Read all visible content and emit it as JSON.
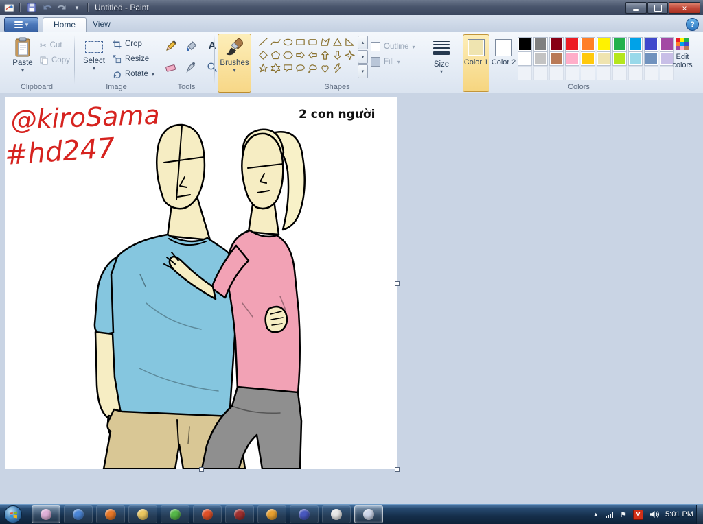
{
  "icons": {
    "dropdown": "▾",
    "scroll_up": "▴",
    "scroll_down": "▾",
    "help": "?",
    "close": "×",
    "hidden_icons": "▲",
    "text_tool": "A",
    "cut": "✂",
    "flag": "⚑",
    "red_badge": "V"
  },
  "window": {
    "title": "Untitled - Paint"
  },
  "tabs": {
    "home": "Home",
    "view": "View"
  },
  "ribbon": {
    "clipboard": {
      "label": "Clipboard",
      "paste": "Paste",
      "cut": "Cut",
      "copy": "Copy"
    },
    "image": {
      "label": "Image",
      "select": "Select",
      "crop": "Crop",
      "resize": "Resize",
      "rotate": "Rotate"
    },
    "tools": {
      "label": "Tools"
    },
    "brushes": {
      "label": "Brushes"
    },
    "shapes": {
      "label": "Shapes",
      "outline": "Outline",
      "fill": "Fill",
      "items": [
        "line",
        "curve",
        "oval",
        "rectangle",
        "rounded-rectangle",
        "polygon",
        "triangle",
        "right-triangle",
        "diamond",
        "pentagon",
        "hexagon",
        "right-arrow",
        "left-arrow",
        "up-arrow",
        "down-arrow",
        "four-point-star",
        "five-point-star",
        "six-point-star",
        "rounded-callout",
        "oval-callout",
        "cloud-callout",
        "heart",
        "lightning"
      ]
    },
    "size": {
      "label": "Size"
    },
    "colors": {
      "label": "Colors",
      "color1_label": "Color 1",
      "color2_label": "Color 2",
      "edit_label": "Edit colors",
      "color1_value": "#EFE4B0",
      "color2_value": "#FFFFFF",
      "palette": [
        [
          "#000000",
          "#7F7F7F",
          "#880015",
          "#ED1C24",
          "#FF7F27",
          "#FFF200",
          "#22B14C",
          "#00A2E8",
          "#3F48CC",
          "#A349A4"
        ],
        [
          "#FFFFFF",
          "#C3C3C3",
          "#B97A57",
          "#FFAEC9",
          "#FFC90E",
          "#EFE4B0",
          "#B5E61D",
          "#99D9EA",
          "#7092BE",
          "#C8BFE7"
        ]
      ]
    }
  },
  "canvas": {
    "signature_line1": "@kiroSama",
    "signature_line2": "#hd247",
    "caption": "2 con người",
    "drawing_colors": {
      "skin": "#F6EDC3",
      "shirt_blue": "#85C6DF",
      "shirt_pink": "#F2A2B5",
      "pants_tan": "#D9C795",
      "pants_gray": "#8F8F8F",
      "signature_red": "#D6231F"
    }
  },
  "taskbar": {
    "clock": "5:01 PM",
    "apps": [
      {
        "name": "photo-app",
        "color": "#e0b0d8",
        "active": true
      },
      {
        "name": "media-player",
        "color": "#4a86d8",
        "active": false
      },
      {
        "name": "firefox",
        "color": "#e87828",
        "active": false
      },
      {
        "name": "file-explorer",
        "color": "#ecc860",
        "active": false
      },
      {
        "name": "antivirus",
        "color": "#55b848",
        "active": false
      },
      {
        "name": "browser",
        "color": "#e05028",
        "active": false
      },
      {
        "name": "app-red",
        "color": "#a03030",
        "active": false
      },
      {
        "name": "folder-orange",
        "color": "#e8a030",
        "active": false
      },
      {
        "name": "video-app",
        "color": "#4858c0",
        "active": false
      },
      {
        "name": "chrome",
        "color": "#e8e8e8",
        "active": false
      },
      {
        "name": "paint",
        "color": "#cfd8ec",
        "active": true
      }
    ]
  }
}
